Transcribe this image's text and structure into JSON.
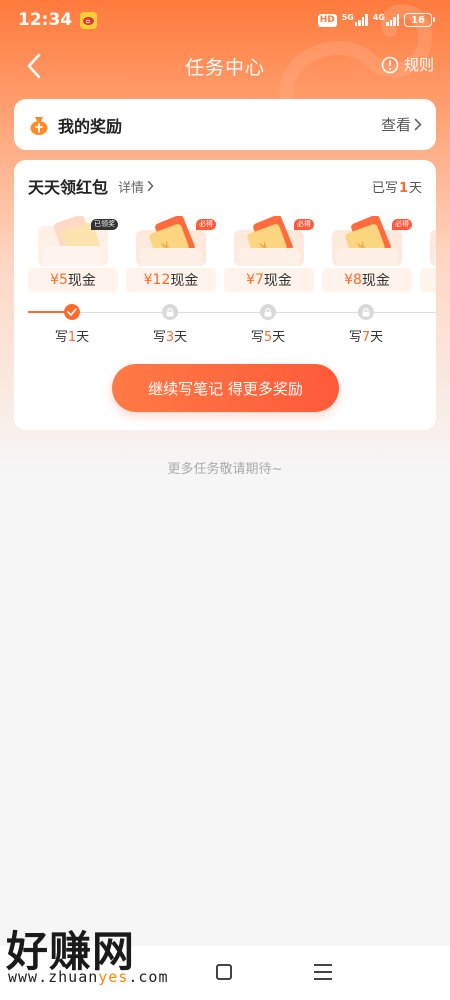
{
  "status_bar": {
    "time": "12:34",
    "hd": "HD",
    "net1": "5G",
    "net2": "4G",
    "battery": "16"
  },
  "nav": {
    "title": "任务中心",
    "rules": "规则"
  },
  "my_rewards": {
    "title": "我的奖励",
    "view": "查看"
  },
  "daily_packet": {
    "title": "天天领红包",
    "details": "详情",
    "written_prefix": "已写",
    "written_days": "1",
    "written_suffix": "天",
    "rewards": [
      {
        "currency": "¥",
        "amount": "5",
        "unit": "现金",
        "badge": "已领奖"
      },
      {
        "currency": "¥",
        "amount": "12",
        "unit": "现金",
        "badge": "必得"
      },
      {
        "currency": "¥",
        "amount": "7",
        "unit": "现金",
        "badge": "必得"
      },
      {
        "currency": "¥",
        "amount": "8",
        "unit": "现金",
        "badge": "必得"
      }
    ],
    "milestones": [
      {
        "prefix": "写",
        "days": "1",
        "suffix": "天",
        "state": "done"
      },
      {
        "prefix": "写",
        "days": "3",
        "suffix": "天",
        "state": "locked"
      },
      {
        "prefix": "写",
        "days": "5",
        "suffix": "天",
        "state": "locked"
      },
      {
        "prefix": "写",
        "days": "7",
        "suffix": "天",
        "state": "locked"
      }
    ],
    "continue_button": "继续写笔记 得更多奖励"
  },
  "footer_note": "更多任务敬请期待~",
  "watermark": {
    "text": "好赚网",
    "url_a": "www.zhuan",
    "url_b": "yes",
    "url_c": ".com"
  },
  "colors": {
    "accent": "#ff6a2a",
    "header_top": "#ff7a3c",
    "page_bg": "#f6f6f6"
  },
  "icons": [
    "weibo-icon",
    "back-arrow-icon",
    "info-icon",
    "money-bag-icon",
    "chevron-right-icon",
    "check-icon",
    "lock-icon",
    "home-icon",
    "menu-icon"
  ]
}
